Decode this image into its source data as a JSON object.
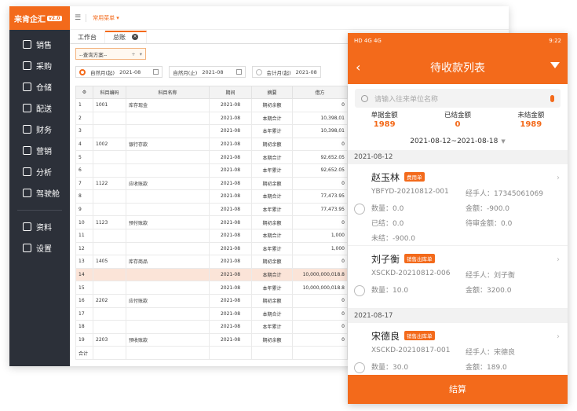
{
  "desktop": {
    "logo": "来肯企汇",
    "version": "v2.0",
    "menu": [
      "销售",
      "采购",
      "仓储",
      "配送",
      "财务",
      "营销",
      "分析",
      "驾驶舱"
    ],
    "menu2": [
      "资料",
      "设置"
    ],
    "common_menu": "常用菜单",
    "tabs": [
      "工作台",
      "总账"
    ],
    "filter_placeholder": "--查询方案--",
    "filter_plus": "+",
    "radio1": "自然月(起)",
    "date1": "2021-08",
    "label2": "自然月(止)",
    "date2": "2021-08",
    "radio2": "会计月(起)",
    "date3": "2021-08",
    "headers": [
      "科目编码",
      "科目名称",
      "期间",
      "摘要",
      "借方"
    ],
    "rows": [
      [
        "1",
        "1001",
        "库存现金",
        "2021-08",
        "期初余额",
        "0"
      ],
      [
        "2",
        "",
        "",
        "2021-08",
        "本期合计",
        "10,398,01"
      ],
      [
        "3",
        "",
        "",
        "2021-08",
        "本年累计",
        "10,398,01"
      ],
      [
        "4",
        "1002",
        "银行存款",
        "2021-08",
        "期初余额",
        "0"
      ],
      [
        "5",
        "",
        "",
        "2021-08",
        "本期合计",
        "92,652.05"
      ],
      [
        "6",
        "",
        "",
        "2021-08",
        "本年累计",
        "92,652.05"
      ],
      [
        "7",
        "1122",
        "应收账款",
        "2021-08",
        "期初余额",
        "0"
      ],
      [
        "8",
        "",
        "",
        "2021-08",
        "本期合计",
        "77,473.95"
      ],
      [
        "9",
        "",
        "",
        "2021-08",
        "本年累计",
        "77,473.95"
      ],
      [
        "10",
        "1123",
        "预付账款",
        "2021-08",
        "期初余额",
        "0"
      ],
      [
        "11",
        "",
        "",
        "2021-08",
        "本期合计",
        "1,000"
      ],
      [
        "12",
        "",
        "",
        "2021-08",
        "本年累计",
        "1,000"
      ],
      [
        "13",
        "1405",
        "库存商品",
        "2021-08",
        "期初余额",
        "0"
      ],
      [
        "14",
        "",
        "",
        "2021-08",
        "本期合计",
        "10,000,000,018.8"
      ],
      [
        "15",
        "",
        "",
        "2021-08",
        "本年累计",
        "10,000,000,018.8"
      ],
      [
        "16",
        "2202",
        "应付账款",
        "2021-08",
        "期初余额",
        "0"
      ],
      [
        "17",
        "",
        "",
        "2021-08",
        "本期合计",
        "0"
      ],
      [
        "18",
        "",
        "",
        "2021-08",
        "本年累计",
        "0"
      ],
      [
        "19",
        "2203",
        "预收账款",
        "2021-08",
        "期初余额",
        "0"
      ]
    ],
    "total_label": "合计"
  },
  "phone": {
    "status_left": "HD 4G 4G",
    "status_time": "9:22",
    "title": "待收款列表",
    "search_placeholder": "请输入往来单位名称",
    "sums": [
      {
        "label": "单据金额",
        "value": "1989"
      },
      {
        "label": "已结金额",
        "value": "0"
      },
      {
        "label": "未结金额",
        "value": "1989"
      }
    ],
    "range": "2021-08-12~2021-08-18",
    "groups": [
      {
        "date": "2021-08-12",
        "cards": [
          {
            "name": "赵玉林",
            "tag": "费用单",
            "code": "YBFYD-20210812-001",
            "handler": "经手人：17345061069",
            "qty": "数量：0.0",
            "amount": "金额：-900.0",
            "settled": "已结：0.0",
            "pending": "待审金额：0.0",
            "unsettled": "未结：-900.0"
          },
          {
            "name": "刘子衡",
            "tag": "销售出库单",
            "code": "XSCKD-20210812-006",
            "handler": "经手人：刘子衡",
            "qty": "数量：10.0",
            "amount": "金额：3200.0"
          }
        ]
      },
      {
        "date": "2021-08-17",
        "cards": [
          {
            "name": "宋德良",
            "tag": "销售出库单",
            "code": "XSCKD-20210817-001",
            "handler": "经手人：宋德良",
            "qty": "数量：30.0",
            "amount": "金额：189.0"
          }
        ]
      }
    ],
    "footer": "结算"
  }
}
